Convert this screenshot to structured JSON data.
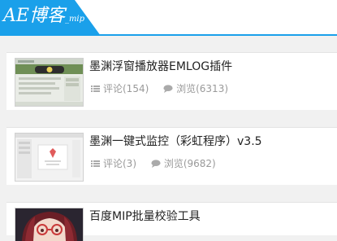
{
  "header": {
    "logo_main": "AE博客",
    "logo_sub": "_mip"
  },
  "posts": [
    {
      "title": "墨渊浮窗播放器EMLOG插件",
      "comments": "评论(154)",
      "views": "浏览(6313)"
    },
    {
      "title": "墨渊一键式监控（彩虹程序）v3.5",
      "comments": "评论(3)",
      "views": "浏览(9682)"
    },
    {
      "title": "百度MIP批量校验工具"
    }
  ],
  "icons": {
    "comment": "list-icon",
    "view": "speech-bubble-icon"
  },
  "colors": {
    "accent": "#1aa0ea",
    "background": "#f1f1f1",
    "card": "#ffffff",
    "title": "#222222",
    "meta": "#999999"
  }
}
